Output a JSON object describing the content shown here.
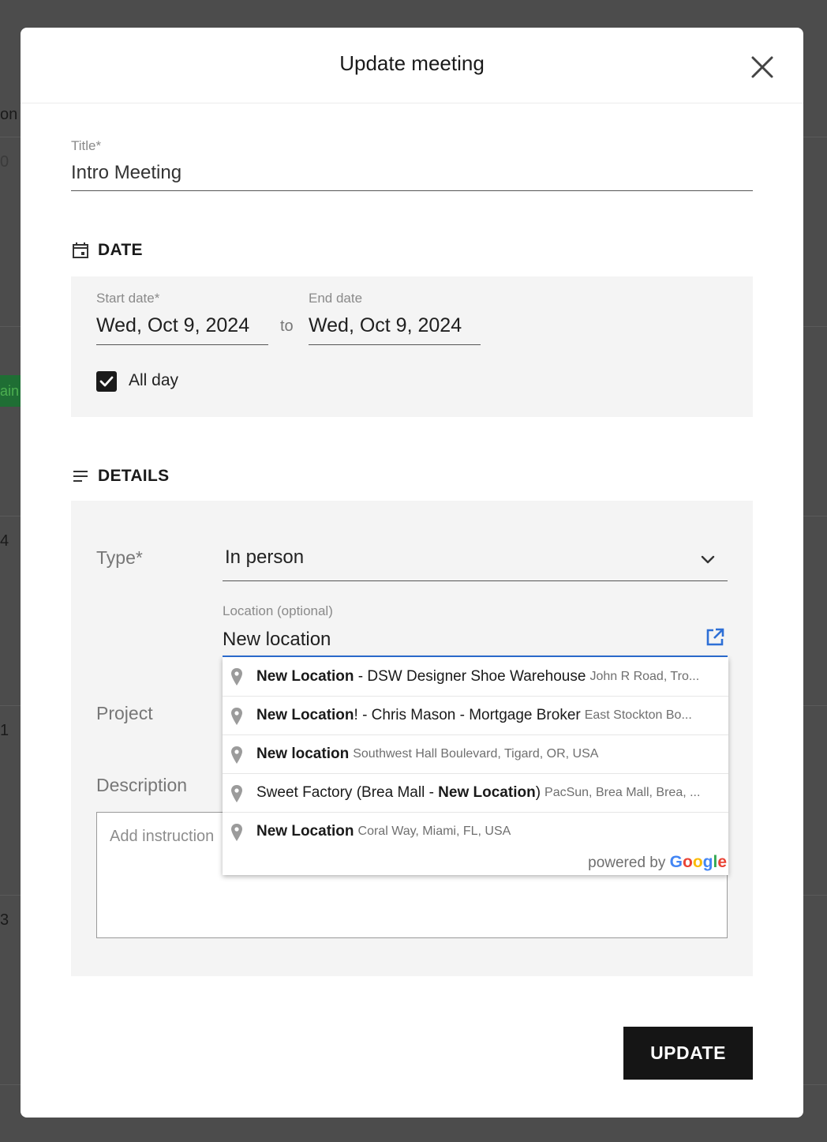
{
  "background": {
    "fragments": [
      "on",
      "0",
      "ain",
      "4",
      "1",
      "3"
    ]
  },
  "modal": {
    "title": "Update meeting",
    "close_icon": "close-icon"
  },
  "title_field": {
    "label": "Title*",
    "value": "Intro Meeting"
  },
  "date_section": {
    "heading": "DATE",
    "icon": "calendar-icon",
    "start_label": "Start date*",
    "start_value": "Wed, Oct 9, 2024",
    "separator": "to",
    "end_label": "End date",
    "end_value": "Wed, Oct 9, 2024",
    "all_day_label": "All day",
    "all_day_checked": true
  },
  "details_section": {
    "heading": "DETAILS",
    "icon": "list-icon",
    "type_label": "Type*",
    "type_value": "In person",
    "location_label": "Location (optional)",
    "location_value": "New location",
    "project_label": "Project",
    "description_label": "Description",
    "description_placeholder": "Add instruction"
  },
  "autocomplete": {
    "suggestions": [
      {
        "pre": "",
        "bold": "New Location",
        "post": " - DSW Designer Shoe Warehouse",
        "secondary": "John R Road, Tro..."
      },
      {
        "pre": "",
        "bold": "New Location",
        "post": "! - Chris Mason - Mortgage Broker",
        "secondary": "East Stockton Bo..."
      },
      {
        "pre": "",
        "bold": "New location",
        "post": "",
        "secondary": "Southwest Hall Boulevard, Tigard, OR, USA"
      },
      {
        "pre": "Sweet Factory (Brea Mall - ",
        "bold": "New Location",
        "post": ")",
        "secondary": "PacSun, Brea Mall, Brea, ..."
      },
      {
        "pre": "",
        "bold": "New Location",
        "post": "",
        "secondary": "Coral Way, Miami, FL, USA"
      }
    ],
    "powered_by": "powered by",
    "brand": "Google",
    "brand_colors": [
      "#4285F4",
      "#EA4335",
      "#FBBC05",
      "#4285F4",
      "#34A853",
      "#EA4335"
    ]
  },
  "footer": {
    "update_label": "UPDATE"
  },
  "colors": {
    "accent": "#2d6fd6",
    "button_bg": "#151515",
    "panel_bg": "#f4f4f4",
    "backdrop": "#4c4c4c"
  }
}
